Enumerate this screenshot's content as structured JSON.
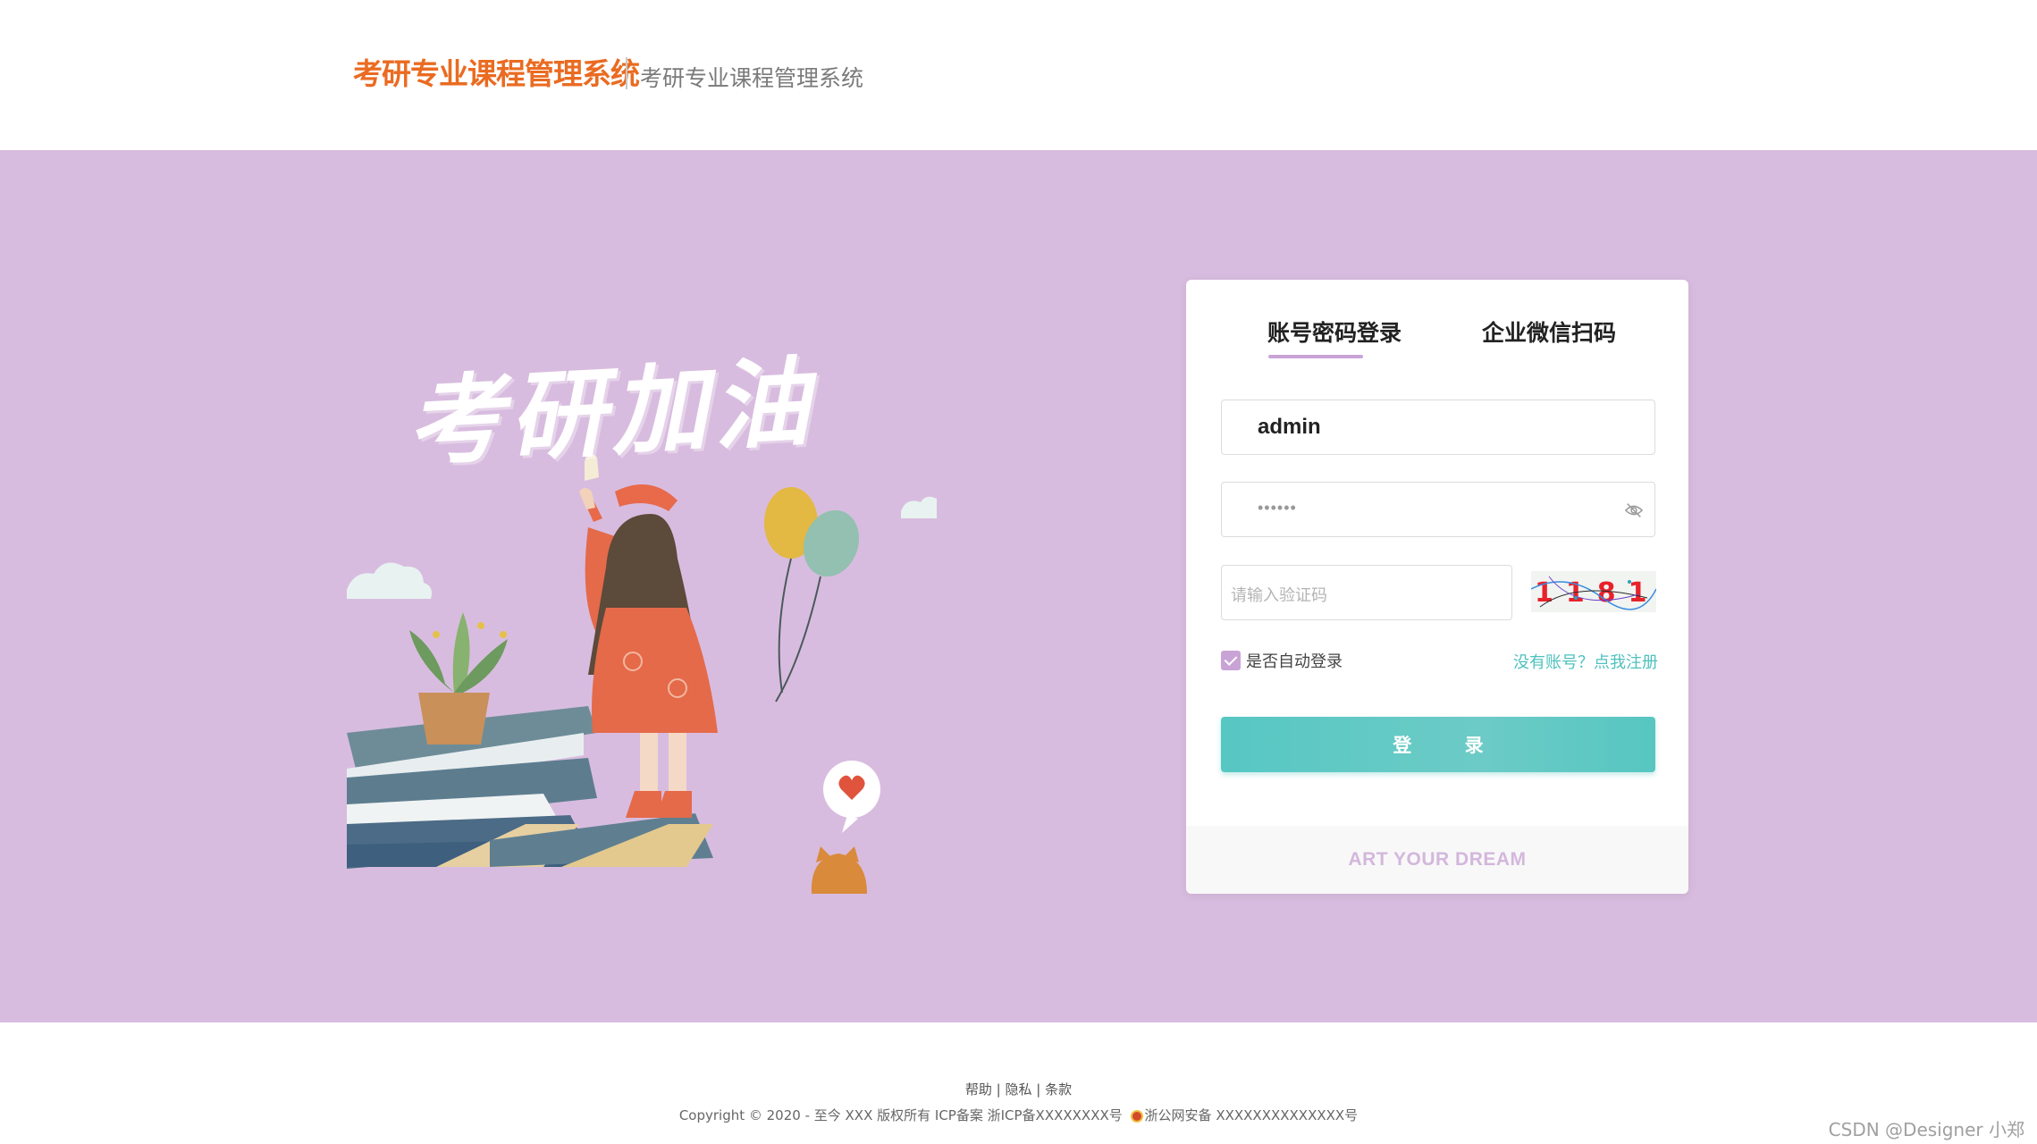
{
  "header": {
    "logo_title": "考研专业课程管理系统",
    "subtitle": "考研专业课程管理系统"
  },
  "banner": {
    "background_color": "#d8bcdf",
    "slogan": "考研加油",
    "illustration_icons": [
      "cloud-icon",
      "potted-plant-icon",
      "books-stack-icon",
      "girl-figure-icon",
      "balloon-icon",
      "heart-bubble-icon",
      "cat-icon"
    ]
  },
  "login": {
    "tabs": [
      {
        "label": "账号密码登录",
        "active": true
      },
      {
        "label": "企业微信扫码",
        "active": false
      }
    ],
    "username_value": "admin",
    "password_mask": "••••••",
    "captcha_placeholder": "请输入验证码",
    "captcha_text": "1181",
    "remember_label": "是否自动登录",
    "remember_checked": true,
    "register_link": "没有账号？点我注册",
    "login_button": "登 录",
    "footer_slogan": "ART YOUR DREAM",
    "accent_color": "#57c7c3",
    "tab_underline_color": "#c9a3d6"
  },
  "footer": {
    "links": [
      "帮助",
      "隐私",
      "条款"
    ],
    "separator": "|",
    "copyright": "Copyright © 2020 - 至今 XXX 版权所有 ICP备案 浙ICP备XXXXXXXX号",
    "police_record": "浙公网安备 XXXXXXXXXXXXXX号",
    "watermark": "CSDN @Designer 小郑"
  }
}
